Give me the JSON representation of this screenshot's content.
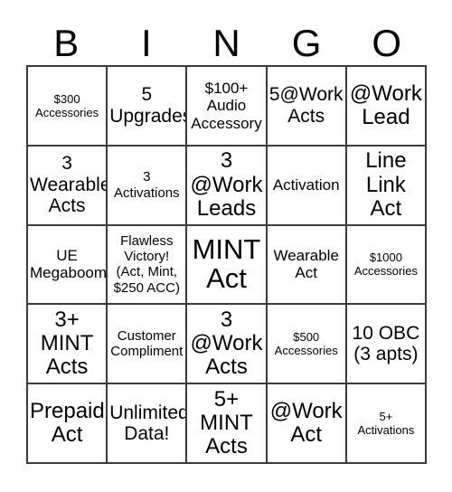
{
  "card": {
    "title_letters": [
      "B",
      "I",
      "N",
      "G",
      "O"
    ],
    "columns": 5,
    "rows": 5,
    "border_color": "#3b3b3b",
    "background_color": "#ffffff",
    "text_color": "#000000",
    "cells": [
      {
        "text": "$300\nAccessories",
        "size": "fs-xs"
      },
      {
        "text": "5\nUpgrades",
        "size": "fs-lg"
      },
      {
        "text": "$100+\nAudio\nAccessory",
        "size": "fs-md"
      },
      {
        "text": "5@Work\nActs",
        "size": "fs-lg"
      },
      {
        "text": "@Work\nLead",
        "size": "fs-xl"
      },
      {
        "text": "3\nWearable\nActs",
        "size": "fs-lg"
      },
      {
        "text": "3\nActivations",
        "size": "fs-sm"
      },
      {
        "text": "3\n@Work\nLeads",
        "size": "fs-xl"
      },
      {
        "text": "Activation",
        "size": "fs-md"
      },
      {
        "text": "Line\nLink\nAct",
        "size": "fs-xl"
      },
      {
        "text": "UE\nMegaboom",
        "size": "fs-md"
      },
      {
        "text": "Flawless\nVictory!\n(Act, Mint,\n$250 ACC)",
        "size": "fs-sm"
      },
      {
        "text": "MINT\nAct",
        "size": "fs-xxl"
      },
      {
        "text": "Wearable\nAct",
        "size": "fs-md"
      },
      {
        "text": "$1000\nAccessories",
        "size": "fs-xs"
      },
      {
        "text": "3+\nMINT\nActs",
        "size": "fs-xl"
      },
      {
        "text": "Customer\nCompliment",
        "size": "fs-sm"
      },
      {
        "text": "3\n@Work\nActs",
        "size": "fs-xl"
      },
      {
        "text": "$500\nAccessories",
        "size": "fs-xs"
      },
      {
        "text": "10 OBC\n(3 apts)",
        "size": "fs-lg"
      },
      {
        "text": "Prepaid\nAct",
        "size": "fs-xl"
      },
      {
        "text": "Unlimited\nData!",
        "size": "fs-lg"
      },
      {
        "text": "5+\nMINT\nActs",
        "size": "fs-xl"
      },
      {
        "text": "@Work\nAct",
        "size": "fs-xl"
      },
      {
        "text": "5+\nActivations",
        "size": "fs-xs"
      }
    ]
  }
}
